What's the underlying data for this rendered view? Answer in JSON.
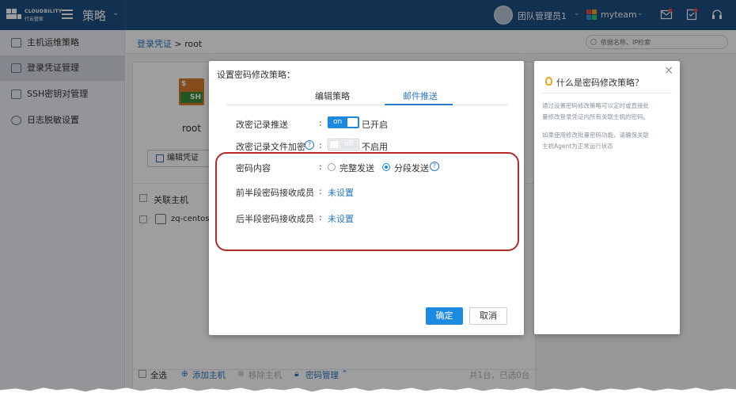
{
  "topbar": {
    "logo_line1": "CLOUDBILITY",
    "logo_line2": "行云管家",
    "section": "策略",
    "user": "团队管理员1",
    "team": "myteam",
    "colors": {
      "bar": "#1d4f82",
      "team_icon": [
        "#e84c3d",
        "#f3a21f",
        "#2ecc71",
        "#3498db"
      ]
    },
    "icons": [
      "message-icon",
      "check-list-icon",
      "headset-icon"
    ]
  },
  "sidebar": {
    "items": [
      {
        "label": "主机运维策略",
        "icon": "host-policy-icon"
      },
      {
        "label": "登录凭证管理",
        "icon": "credential-icon",
        "active": true
      },
      {
        "label": "SSH密钥对管理",
        "icon": "ssh-key-icon"
      },
      {
        "label": "日志脱敏设置",
        "icon": "eye-icon"
      }
    ]
  },
  "breadcrumb": {
    "link": "登录凭证",
    "sep": " > ",
    "current": "root"
  },
  "search": {
    "placeholder": "依据名称、IP检索"
  },
  "card": {
    "icon_dollar": "$",
    "icon_label": "SH",
    "name": "root",
    "edit_label": "编辑凭证",
    "hosts_header": "关联主机",
    "host": "zq-centos7",
    "footer": {
      "select_all": "全选",
      "add_host": "添加主机",
      "remove_host": "移除主机",
      "password_mgmt": "密码管理",
      "summary": "共1台，已选0台"
    }
  },
  "modal": {
    "title": "设置密码修改策略：",
    "tabs": [
      {
        "label": "编辑策略"
      },
      {
        "label": "邮件推送",
        "active": true
      }
    ],
    "rows": {
      "push_label": "改密记录推送",
      "push_toggle": "on",
      "push_status": "已开启",
      "encrypt_label": "改密记录文件加密",
      "encrypt_toggle": "off",
      "encrypt_status": "不启用",
      "content_label": "密码内容",
      "content_option1": "完整发送",
      "content_option2": "分段发送",
      "first_label": "前半段密码接收成员",
      "first_value": "未设置",
      "second_label": "后半段密码接收成员",
      "second_value": "未设置"
    },
    "colon": ":",
    "help_mark": "?",
    "ok_label": "确定",
    "cancel_label": "取消",
    "colors": {
      "accent": "#1c8ae0",
      "highlight": "#b52a2a"
    }
  },
  "help_panel": {
    "close": "×",
    "title": "什么是密码修改策略？",
    "para1_l1": "通过设置密码修改策略可以定时或直接批",
    "para1_l2": "量修改登录凭证内所有关联主机的密码。",
    "para2_l1": "如果使用修改批量密码功能，请确保关联",
    "para2_l2": "主机Agent为正常运行状态"
  }
}
